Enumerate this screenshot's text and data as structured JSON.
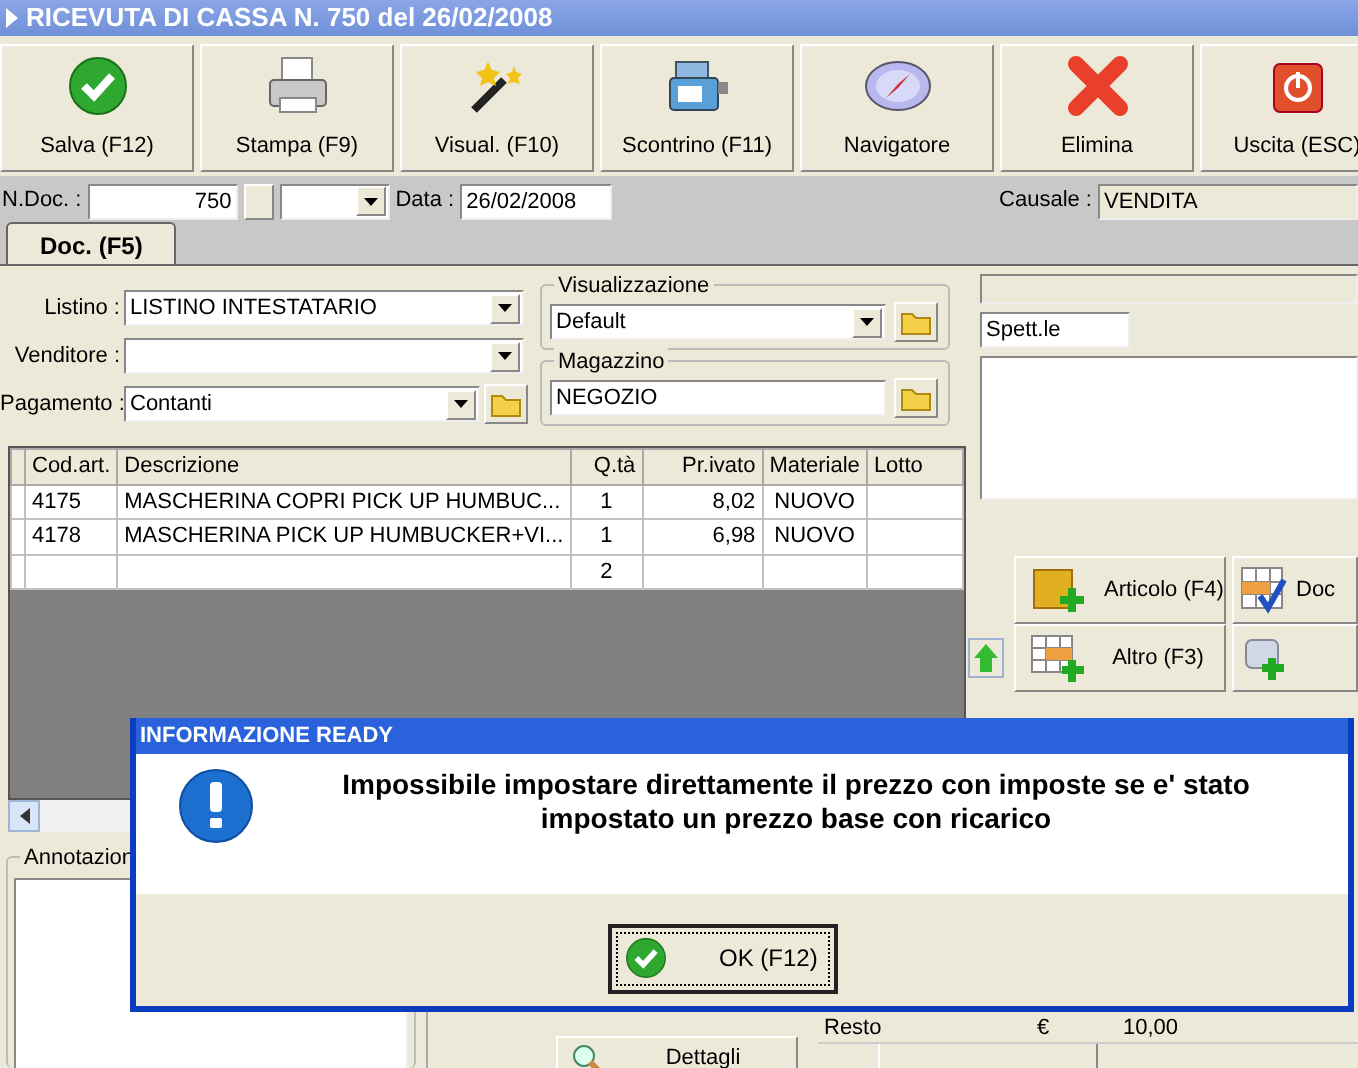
{
  "window": {
    "title": "RICEVUTA DI CASSA N. 750  del 26/02/2008"
  },
  "toolbar": [
    {
      "label": "Salva (F12)",
      "kind": "check"
    },
    {
      "label": "Stampa (F9)",
      "kind": "printer"
    },
    {
      "label": "Visual. (F10)",
      "kind": "wand"
    },
    {
      "label": "Scontrino (F11)",
      "kind": "register"
    },
    {
      "label": "Navigatore",
      "kind": "compass"
    },
    {
      "label": "Elimina",
      "kind": "cross"
    },
    {
      "label": "Uscita (ESC)",
      "kind": "power"
    }
  ],
  "header": {
    "n_doc_label": "N.Doc. :",
    "n_doc": "750",
    "data_label": "Data :",
    "data": "26/02/2008",
    "causale_label": "Causale :",
    "causale": "VENDITA"
  },
  "tabs": [
    {
      "label": "Doc. (F5)",
      "selected": true
    }
  ],
  "form": {
    "listino": {
      "label": "Listino :",
      "value": "LISTINO INTESTATARIO"
    },
    "venditore": {
      "label": "Venditore :"
    },
    "pagamento": {
      "label": "Pagamento :",
      "value": "Contanti"
    }
  },
  "visualizzazione": {
    "legend": "Visualizzazione",
    "value": "Default"
  },
  "magazzino": {
    "legend": "Magazzino",
    "value": "NEGOZIO"
  },
  "table": {
    "columns": [
      "Cod.art.",
      "Descrizione",
      "Q.tà",
      "Pr.ivato",
      "Materiale",
      "Lotto"
    ],
    "rows": [
      {
        "cod": "4175",
        "descrizione": "MASCHERINA COPRI PICK UP HUMBUC...",
        "qta": "1",
        "prezzo": "8,02",
        "materiale": "NUOVO"
      },
      {
        "cod": "4178",
        "descrizione": "MASCHERINA PICK UP HUMBUCKER+VI...",
        "qta": "1",
        "prezzo": "6,98",
        "materiale": "NUOVO"
      },
      {
        "qta": "2"
      }
    ]
  },
  "right_panel": {
    "address_label": "Spett.le",
    "buttons": [
      {
        "label": "Articolo (F4)",
        "kind": "box"
      },
      {
        "label": "Altro (F3)",
        "kind": "grid"
      }
    ],
    "side_buttons": [
      {
        "label": "Doc",
        "kind": "grid-check"
      },
      {
        "kind": "scroll"
      }
    ]
  },
  "annotations": {
    "legend": "Annotazion"
  },
  "totals": [
    {
      "label": "Resto",
      "currency": "€",
      "value": "10,00"
    }
  ],
  "details_button": {
    "label": "Dettagli"
  },
  "dialog": {
    "title": "INFORMAZIONE READY",
    "message": "Impossibile impostare direttamente il prezzo con imposte se e' stato impostato un prezzo base con ricarico",
    "button": "OK (F12)"
  }
}
